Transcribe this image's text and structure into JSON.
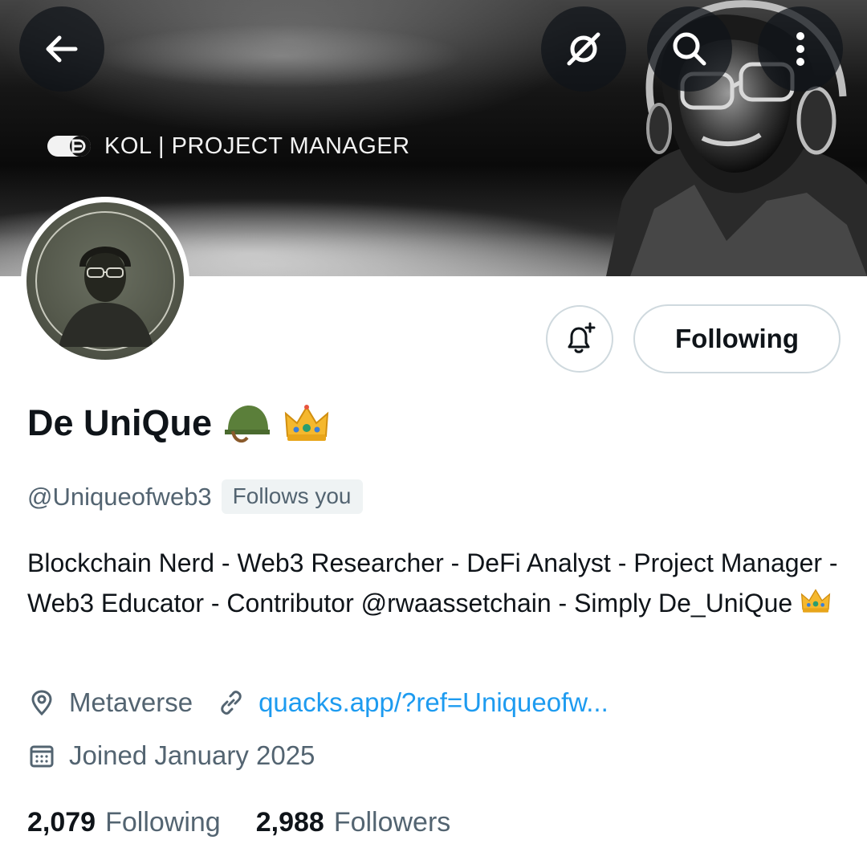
{
  "banner": {
    "text": "KOL | PROJECT MANAGER",
    "buttons": {
      "back": "arrow-left-icon",
      "grok": "grok-slash-circle-icon",
      "search": "search-icon",
      "more": "more-vertical-icon"
    }
  },
  "profile": {
    "display_name": "De UniQue",
    "name_emojis": [
      "military-helmet-emoji",
      "crown-emoji"
    ],
    "handle": "@Uniqueofweb3",
    "follows_badge": "Follows you",
    "bio": "Blockchain Nerd - Web3 Researcher - DeFi Analyst - Project Manager - Web3 Educator - Contributor @rwaassetchain - Simply De_UniQue",
    "location": "Metaverse",
    "website": "quacks.app/?ref=Uniqueofw...",
    "joined": "Joined January 2025"
  },
  "actions": {
    "notify_icon": "bell-plus-icon",
    "following_label": "Following"
  },
  "stats": {
    "following_count": "2,079",
    "following_label": "Following",
    "followers_count": "2,988",
    "followers_label": "Followers"
  },
  "colors": {
    "link": "#1d9bf0",
    "secondary_text": "#536471",
    "primary_text": "#0f1419",
    "border": "#cfd9de"
  }
}
